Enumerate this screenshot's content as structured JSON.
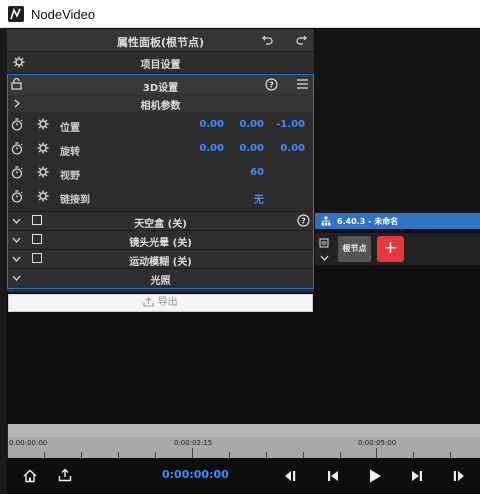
{
  "window": {
    "title": "NodeVideo"
  },
  "properties_panel": {
    "title": "属性面板(根节点)",
    "project_settings": "项目设置",
    "section_3d": {
      "title": "3D设置"
    },
    "camera_params": {
      "title": "相机参数"
    },
    "props": [
      {
        "label": "位置",
        "values": [
          "0.00",
          "0.00",
          "-1.00"
        ]
      },
      {
        "label": "旋转",
        "values": [
          "0.00",
          "0.00",
          "0.00"
        ]
      },
      {
        "label": "视野",
        "values": [
          "60"
        ]
      },
      {
        "label": "链接到",
        "values": [
          "无"
        ]
      }
    ],
    "toggles": [
      {
        "label": "天空盒 (关)"
      },
      {
        "label": "镜头光晕 (关)"
      },
      {
        "label": "运动模糊 (关)"
      }
    ],
    "lighting": {
      "title": "光照"
    },
    "export_label": "导出"
  },
  "timeline": {
    "sequence_title": "6.40.3 - 未命名",
    "root_clip_label": "根节点",
    "add_label": "+",
    "ruler_marks": [
      "0:00:00:00",
      "0:00:02:15",
      "0:00:05:00"
    ],
    "current_time": "0:00:00:00"
  },
  "colors": {
    "accent": "#2f73c9",
    "value_blue": "#3d8bff",
    "add_red": "#e8363d"
  }
}
